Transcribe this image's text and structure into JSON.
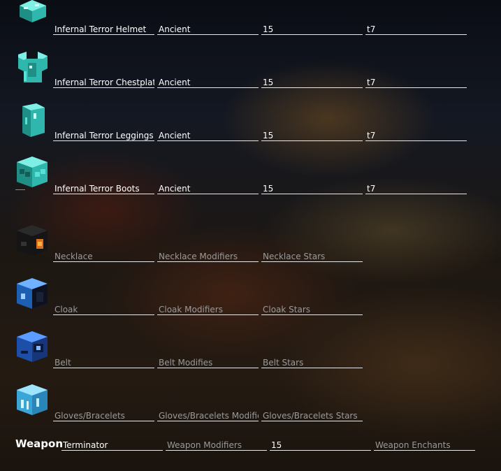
{
  "armor": [
    {
      "item": "Infernal Terror Helmet",
      "reforge": "Ancient",
      "stars": "15",
      "tier": "t7",
      "icon": "diamond-helmet-icon"
    },
    {
      "item": "Infernal Terror Chestplat",
      "reforge": "Ancient",
      "stars": "15",
      "tier": "t7",
      "icon": "diamond-chestplate-icon"
    },
    {
      "item": "Infernal Terror Leggings",
      "reforge": "Ancient",
      "stars": "15",
      "tier": "t7",
      "icon": "diamond-leggings-icon"
    },
    {
      "item": "Infernal Terror Boots",
      "reforge": "Ancient",
      "stars": "15",
      "tier": "t7",
      "icon": "diamond-boots-icon"
    }
  ],
  "equipment": [
    {
      "item_placeholder": "Necklace",
      "modifiers_placeholder": "Necklace Modifiers",
      "stars_placeholder": "Necklace Stars",
      "icon": "necklace-head-icon"
    },
    {
      "item_placeholder": "Cloak",
      "modifiers_placeholder": "Cloak Modifiers",
      "stars_placeholder": "Cloak Stars",
      "icon": "cloak-head-icon"
    },
    {
      "item_placeholder": "Belt",
      "modifiers_placeholder": "Belt Modifies",
      "stars_placeholder": "Belt Stars",
      "icon": "belt-head-icon"
    },
    {
      "item_placeholder": "Gloves/Bracelets",
      "modifiers_placeholder": "Gloves/Bracelets Modifiers",
      "stars_placeholder": "Gloves/Bracelets Stars",
      "icon": "gloves-head-icon"
    }
  ],
  "weapon": {
    "label": "Weapon",
    "item": "Terminator",
    "modifiers_placeholder": "Weapon Modifiers",
    "stars": "15",
    "enchants_placeholder": "Weapon Enchants"
  },
  "colors": {
    "field_text": "#ffffff",
    "placeholder_text": "#9a9a9a",
    "underline": "#e8e8e8",
    "diamond": "#4fd6cc"
  }
}
